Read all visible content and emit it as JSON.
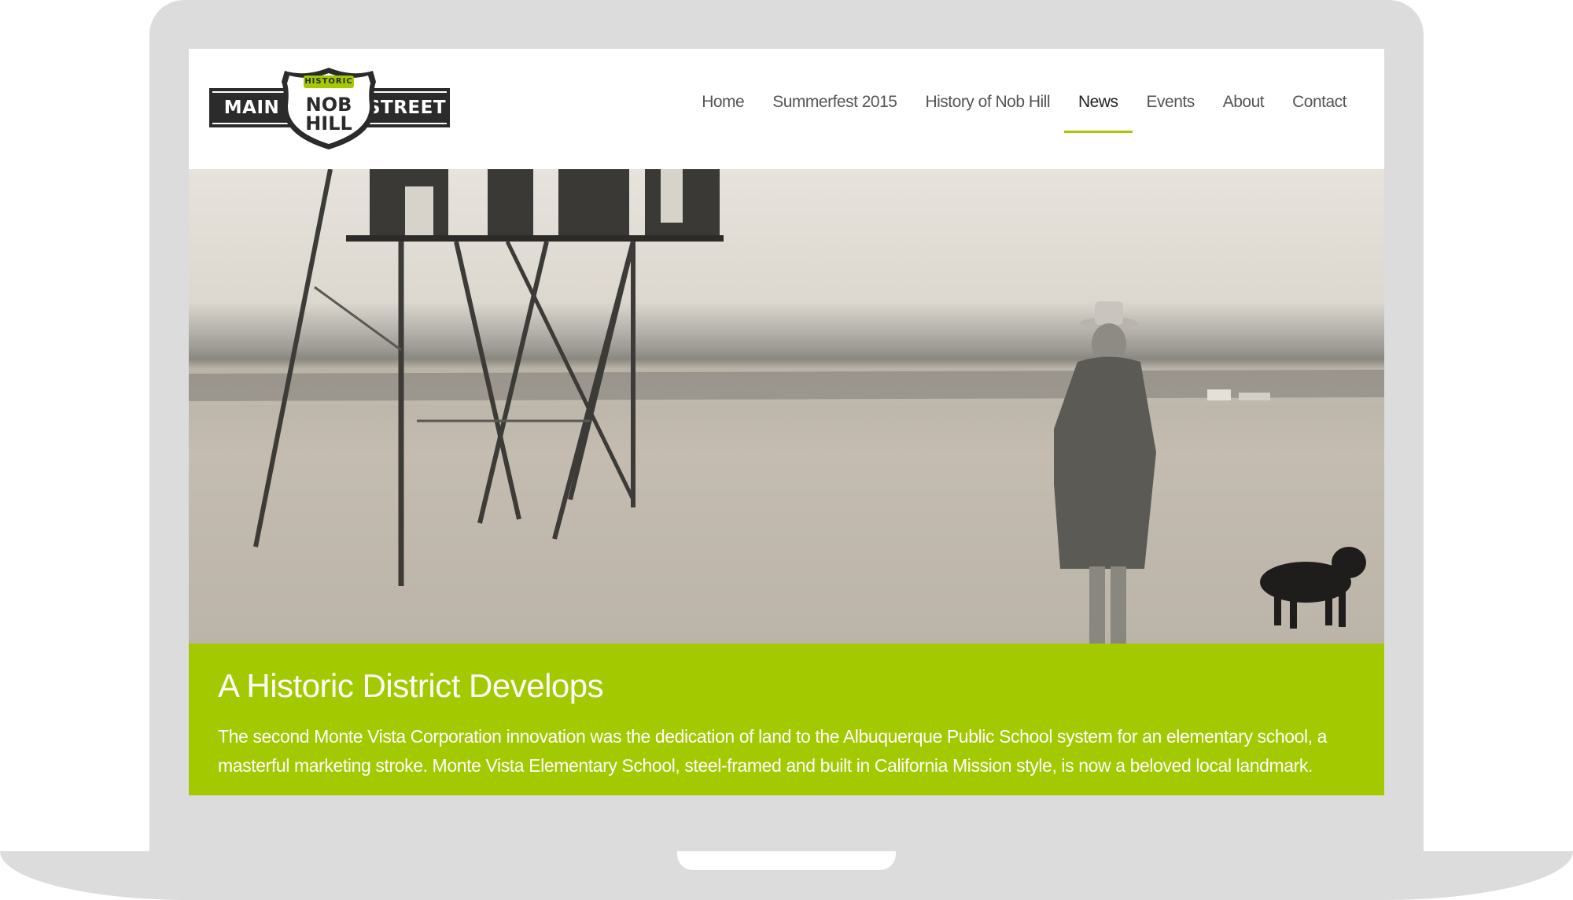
{
  "logo": {
    "left_word": "MAIN",
    "right_word": "STREET",
    "shield_top": "HISTORIC",
    "shield_line1": "NOB",
    "shield_line2": "HILL"
  },
  "nav": {
    "items": [
      {
        "label": "Home"
      },
      {
        "label": "Summerfest 2015"
      },
      {
        "label": "History of Nob Hill"
      },
      {
        "label": "News",
        "active": true
      },
      {
        "label": "Events"
      },
      {
        "label": "About"
      },
      {
        "label": "Contact"
      }
    ]
  },
  "hero": {
    "title": "A Historic District Develops",
    "body": "The second Monte Vista Corporation innovation was the dedication of land to the Albuquerque Public School system for an elementary school, a masterful marketing stroke. Monte Vista Elementary School, steel-framed and built in California Mission style, is now a beloved local landmark."
  },
  "colors": {
    "accent": "#a3c900",
    "frame": "#dcdcdc",
    "logo_dark": "#2b2b2b"
  }
}
